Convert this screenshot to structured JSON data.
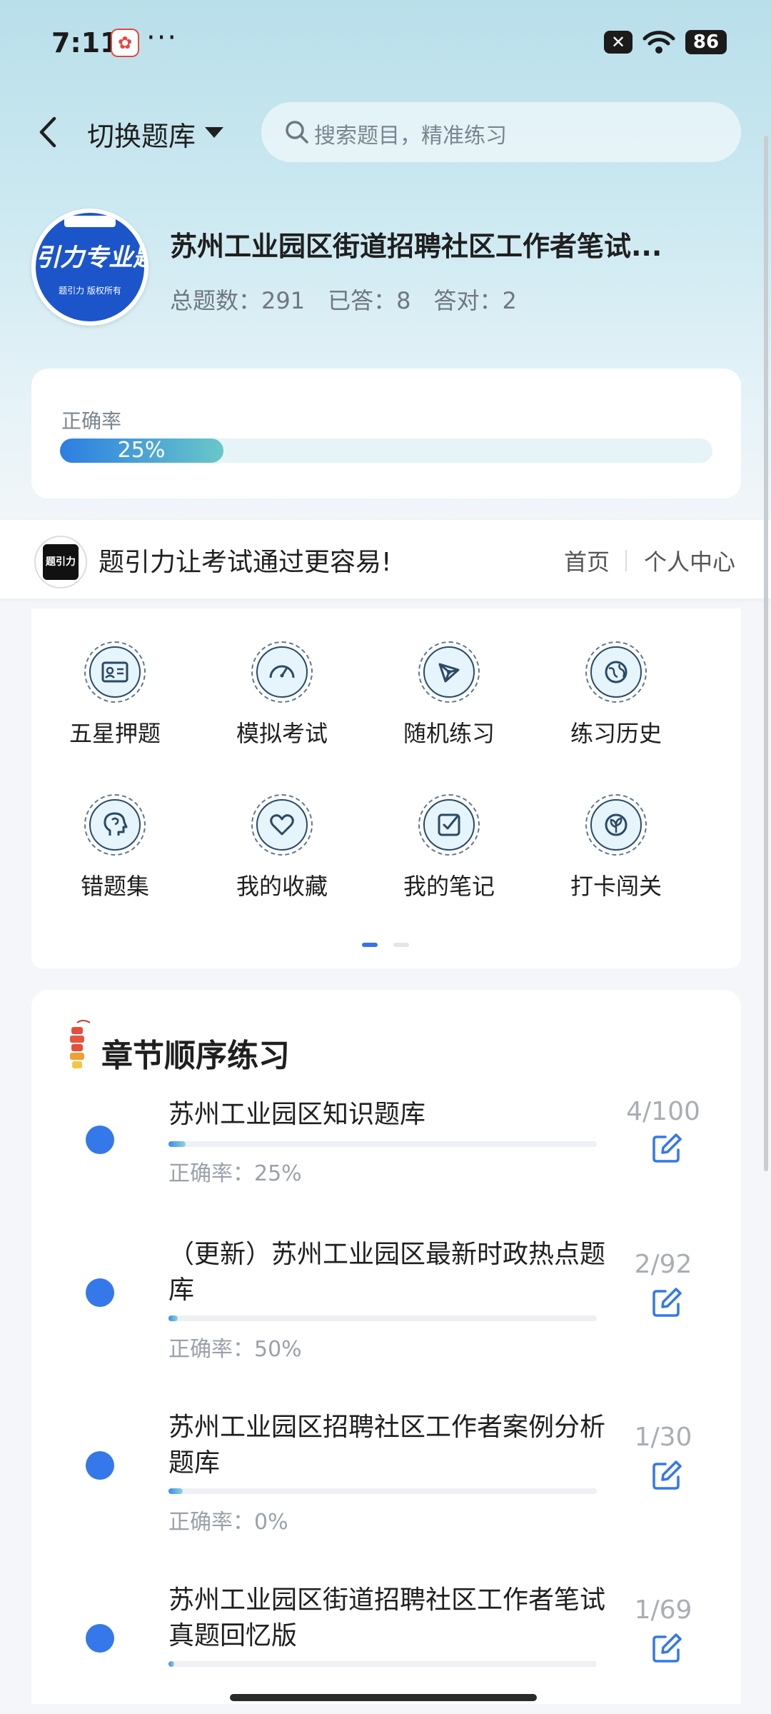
{
  "status_bar": {
    "time": "7:11",
    "dots": "···",
    "battery": "86",
    "x_label": "✕"
  },
  "header": {
    "switch_label": "切换题库",
    "search_placeholder": "搜索题目，精准练习"
  },
  "bank": {
    "logo_text": "引力专业题",
    "logo_sub": "题引力 版权所有",
    "title": "苏州工业园区街道招聘社区工作者笔试...",
    "total_label": "总题数：291",
    "answered_label": "已答：8",
    "correct_label": "答对：2"
  },
  "accuracy": {
    "label": "正确率",
    "value_text": "25%",
    "value": 0.25
  },
  "brand": {
    "logo_text": "题引力",
    "slogan": "题引力让考试通过更容易!",
    "nav_home": "首页",
    "nav_me": "个人中心"
  },
  "grid": {
    "items": [
      {
        "label": "五星押题",
        "icon": "id-card-icon"
      },
      {
        "label": "模拟考试",
        "icon": "gauge-icon"
      },
      {
        "label": "随机练习",
        "icon": "network-icon"
      },
      {
        "label": "练习历史",
        "icon": "globe-icon"
      },
      {
        "label": "错题集",
        "icon": "head-icon"
      },
      {
        "label": "我的收藏",
        "icon": "heart-icon"
      },
      {
        "label": "我的笔记",
        "icon": "note-check-icon"
      },
      {
        "label": "打卡闯关",
        "icon": "plant-icon"
      }
    ]
  },
  "chapters": {
    "title": "章节顺序练习",
    "items": [
      {
        "name": "苏州工业园区知识题库",
        "accuracy": "正确率：25%",
        "count": "4/100",
        "progress": 0.04
      },
      {
        "name": "（更新）苏州工业园区最新时政热点题库",
        "accuracy": "正确率：50%",
        "count": "2/92",
        "progress": 0.022
      },
      {
        "name": "苏州工业园区招聘社区工作者案例分析题库",
        "accuracy": "正确率：0%",
        "count": "1/30",
        "progress": 0.033
      },
      {
        "name": "苏州工业园区街道招聘社区工作者笔试真题回忆版",
        "accuracy": "",
        "count": "1/69",
        "progress": 0.014
      }
    ]
  },
  "colors": {
    "accent": "#3478ea",
    "progress_start": "#2c7ee2",
    "progress_end": "#69c7c9"
  }
}
